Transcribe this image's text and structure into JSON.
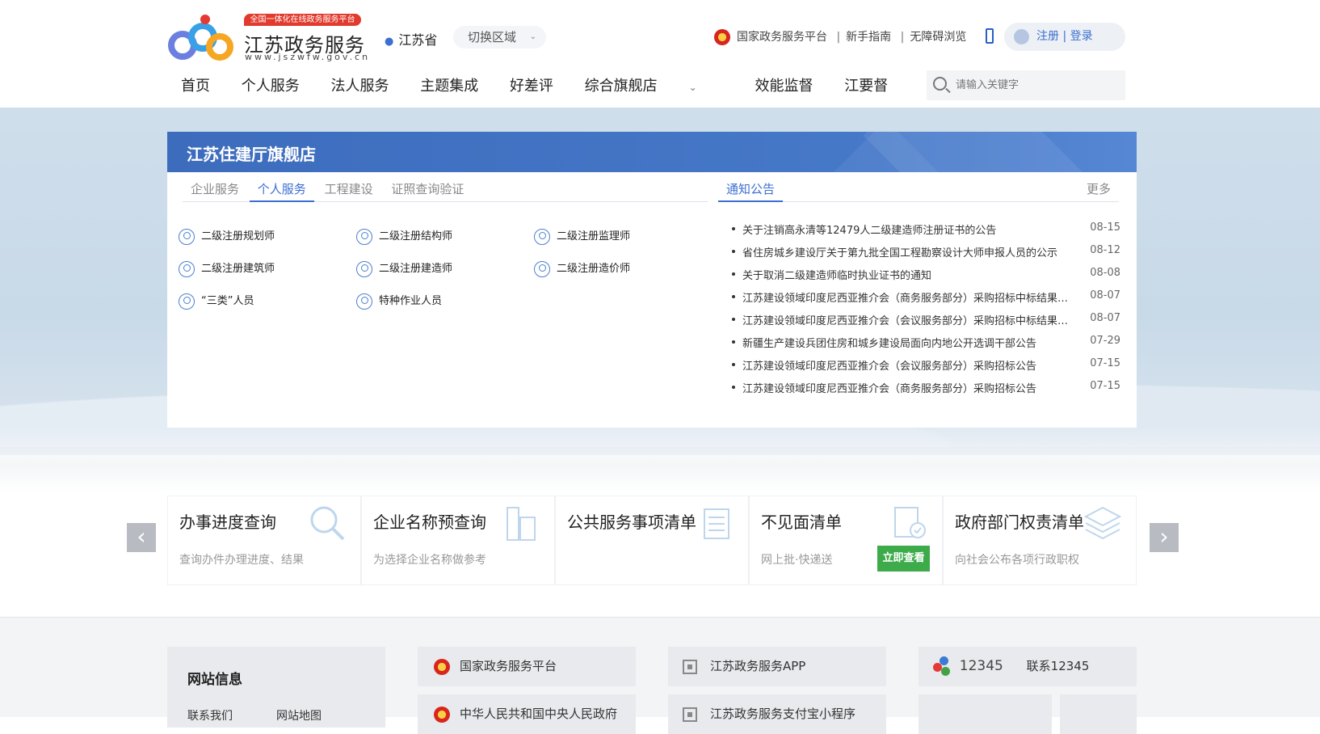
{
  "header": {
    "badge": "全国一体化在线政务服务平台",
    "site_name": "江苏政务服务",
    "site_url": "www.jszwfw.gov.cn",
    "region": "江苏省",
    "switch_region": "切换区域",
    "top_links": [
      "国家政务服务平台",
      "新手指南",
      "无障碍浏览"
    ],
    "register": "注册",
    "login": "登录",
    "nav": [
      "首页",
      "个人服务",
      "法人服务",
      "主题集成",
      "好差评",
      "综合旗舰店",
      "效能监督",
      "江要督"
    ],
    "search_placeholder": "请输入关键字"
  },
  "store": {
    "title": "江苏住建厅旗舰店",
    "tabs": [
      "企业服务",
      "个人服务",
      "工程建设",
      "证照查询验证"
    ],
    "active_tab": "个人服务",
    "services": [
      "二级注册规划师",
      "二级注册结构师",
      "二级注册监理师",
      "二级注册建筑师",
      "二级注册建造师",
      "二级注册造价师",
      "“三类”人员",
      "特种作业人员"
    ],
    "notice_tab": "通知公告",
    "more": "更多",
    "notices": [
      {
        "title": "关于注销高永清等12479人二级建造师注册证书的公告",
        "date": "08-15"
      },
      {
        "title": "省住房城乡建设厅关于第九批全国工程勘察设计大师申报人员的公示",
        "date": "08-12"
      },
      {
        "title": "关于取消二级建造师临时执业证书的通知",
        "date": "08-08"
      },
      {
        "title": "江苏建设领域印度尼西亚推介会（商务服务部分）采购招标中标结果公...",
        "date": "08-07"
      },
      {
        "title": "江苏建设领域印度尼西亚推介会（会议服务部分）采购招标中标结果公...",
        "date": "08-07"
      },
      {
        "title": "新疆生产建设兵团住房和城乡建设局面向内地公开选调干部公告",
        "date": "07-29"
      },
      {
        "title": "江苏建设领域印度尼西亚推介会（会议服务部分）采购招标公告",
        "date": "07-15"
      },
      {
        "title": "江苏建设领域印度尼西亚推介会（商务服务部分）采购招标公告",
        "date": "07-15"
      }
    ]
  },
  "cards": [
    {
      "title": "办事进度查询",
      "desc": "查询办件办理进度、结果"
    },
    {
      "title": "企业名称预查询",
      "desc": "为选择企业名称做参考"
    },
    {
      "title": "公共服务事项清单",
      "desc": ""
    },
    {
      "title": "不见面清单",
      "desc": "网上批·快递送",
      "button": "立即查看"
    },
    {
      "title": "政府部门权责清单",
      "desc": "向社会公布各项行政职权"
    }
  ],
  "footer": {
    "info_title": "网站信息",
    "info_links": [
      "联系我们",
      "网站地图"
    ],
    "links": [
      "国家政务服务平台",
      "江苏政务服务APP",
      "联系12345",
      "中华人民共和国中央人民政府",
      "江苏政务服务支付宝小程序"
    ],
    "hotline_logo": "12345"
  },
  "colors": {
    "accent": "#3b6fd1",
    "store_header": "#4678c8",
    "green_button": "#3dab4a"
  }
}
